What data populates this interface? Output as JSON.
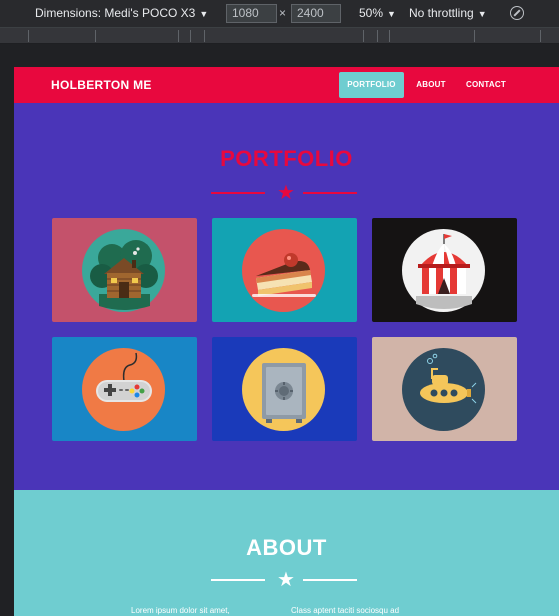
{
  "devtools": {
    "device_label": "Dimensions: Medi's POCO X3",
    "width_value": "1080",
    "times_symbol": "×",
    "height_value": "2400",
    "zoom_label": "50%",
    "throttle_label": "No throttling",
    "caret": "▼"
  },
  "nav": {
    "brand": "HOLBERTON ME",
    "links": [
      {
        "label": "PORTFOLIO",
        "active": true
      },
      {
        "label": "ABOUT",
        "active": false
      },
      {
        "label": "CONTACT",
        "active": false
      }
    ]
  },
  "portfolio": {
    "title": "PORTFOLIO",
    "star": "★",
    "tiles": [
      {
        "icon": "log-cabin-icon",
        "background": "#c4526b",
        "circle": "#3aa89a"
      },
      {
        "icon": "cake-slice-icon",
        "background": "#13a3b3",
        "circle": "#e8574f"
      },
      {
        "icon": "circus-tent-icon",
        "background": "#151313",
        "circle": "#f2f2f2"
      },
      {
        "icon": "game-controller-icon",
        "background": "#1886c6",
        "circle": "#f07a45"
      },
      {
        "icon": "safe-icon",
        "background": "#1a3aba",
        "circle": "#f5c65a"
      },
      {
        "icon": "submarine-icon",
        "background": "#d1b4a8",
        "circle": "#2f4b5e"
      }
    ]
  },
  "about": {
    "title": "ABOUT",
    "star": "★",
    "text_left": "Lorem ipsum dolor sit amet,",
    "text_right": "Class aptent taciti sociosqu ad"
  },
  "colors": {
    "brand_red": "#e8083e",
    "portfolio_bg": "#4a35b8",
    "about_bg": "#6fcdd0"
  }
}
